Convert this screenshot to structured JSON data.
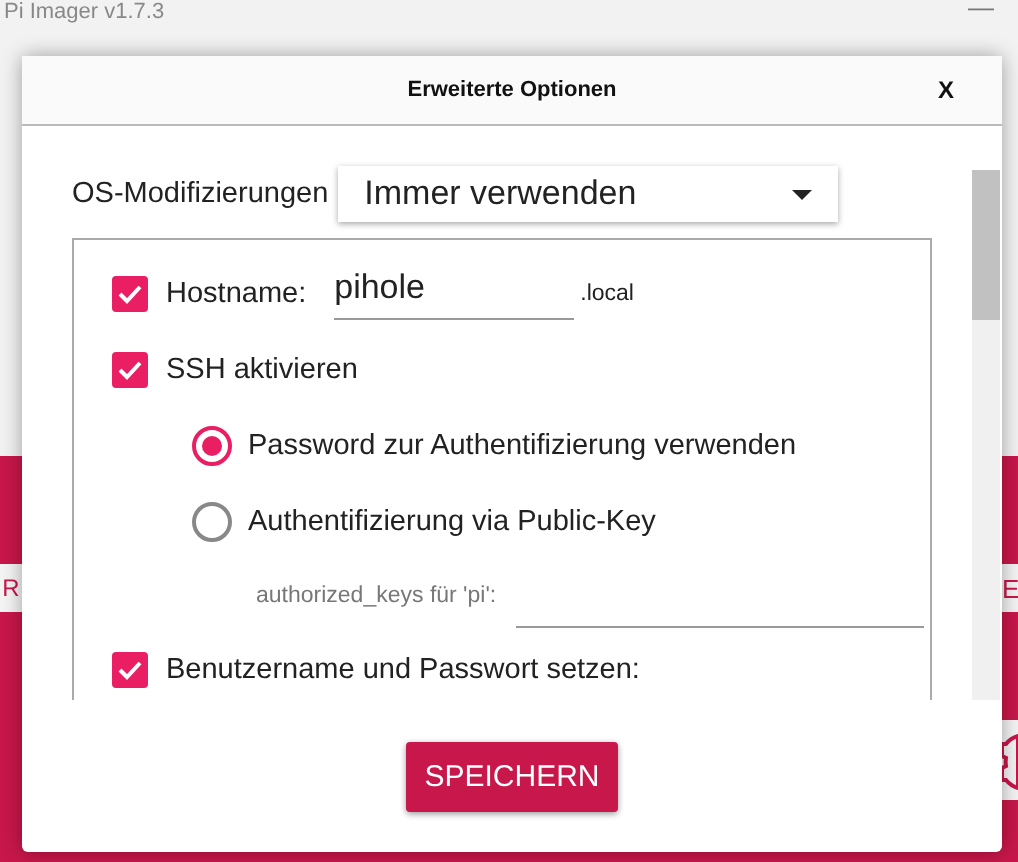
{
  "app": {
    "title": "Pi Imager v1.7.3",
    "minimize": "—",
    "side_buttons": [
      {
        "label": "R"
      },
      {
        "label": "E"
      }
    ]
  },
  "dialog": {
    "title": "Erweiterte Optionen",
    "close": "X",
    "os_mod": {
      "label": "OS-Modifizierungen",
      "value": "Immer verwenden"
    },
    "options": [
      {
        "kind": "checkbox",
        "label": "Hostname:",
        "checked": true,
        "value": "pihole",
        "suffix": ".local"
      },
      {
        "kind": "checkbox",
        "label": "SSH aktivieren",
        "checked": true
      },
      {
        "kind": "radio",
        "label": "Password zur Authentifizierung verwenden",
        "selected": true
      },
      {
        "kind": "radio",
        "label": "Authentifizierung via Public-Key",
        "selected": false
      },
      {
        "kind": "keyfield",
        "label": "authorized_keys für 'pi':"
      },
      {
        "kind": "checkbox",
        "label": "Benutzername und Passwort setzen:",
        "checked": true
      }
    ],
    "save": "SPEICHERN"
  }
}
